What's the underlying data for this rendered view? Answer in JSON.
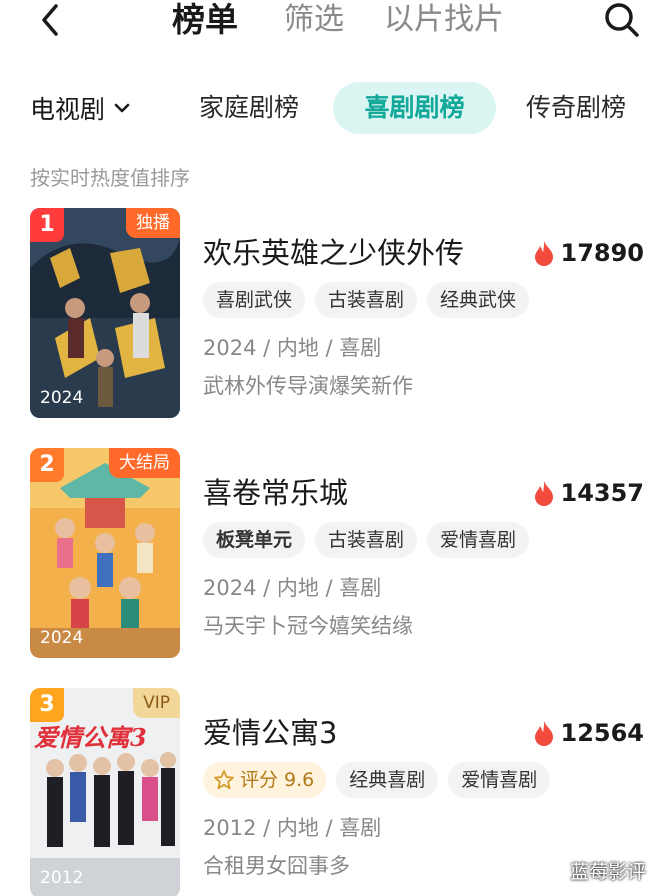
{
  "header": {
    "tabs": [
      {
        "label": "榜单",
        "active": true
      },
      {
        "label": "筛选",
        "active": false
      },
      {
        "label": "以片找片",
        "active": false
      }
    ]
  },
  "categories": {
    "selector": "电视剧",
    "tabs": [
      "家庭剧榜",
      "喜剧剧榜",
      "传奇剧榜"
    ],
    "active": "喜剧剧榜"
  },
  "sort_hint": "按实时热度值排序",
  "items": [
    {
      "rank": "1",
      "badge": "独播",
      "poster_year": "2024",
      "title": "欢乐英雄之少侠外传",
      "heat": "17890",
      "tags": [
        "喜剧武侠",
        "古装喜剧",
        "经典武侠"
      ],
      "meta": "2024 / 内地 / 喜剧",
      "desc": "武林外传导演爆笑新作"
    },
    {
      "rank": "2",
      "badge": "大结局",
      "poster_year": "2024",
      "title": "喜卷常乐城",
      "heat": "14357",
      "tags": [
        "板凳单元",
        "古装喜剧",
        "爱情喜剧"
      ],
      "meta": "2024 / 内地 / 喜剧",
      "desc": "马天宇卜冠今嬉笑结缘"
    },
    {
      "rank": "3",
      "badge": "VIP",
      "poster_year": "2012",
      "poster_text": "爱情公寓3",
      "title": "爱情公寓3",
      "heat": "12564",
      "rating_label": "评分",
      "rating_value": "9.6",
      "tags": [
        "经典喜剧",
        "爱情喜剧"
      ],
      "meta": "2012 / 内地 / 喜剧",
      "desc": "合租男女囧事多"
    }
  ],
  "watermark": "蓝莓影评",
  "colors": {
    "accent": "#12a89a",
    "accent_bg": "#daf5f2",
    "rank_1": "#ff3b3b",
    "rank_2": "#ff7a2b",
    "rank_3": "#ffa41f",
    "heat_flame": "#f24a3d"
  }
}
